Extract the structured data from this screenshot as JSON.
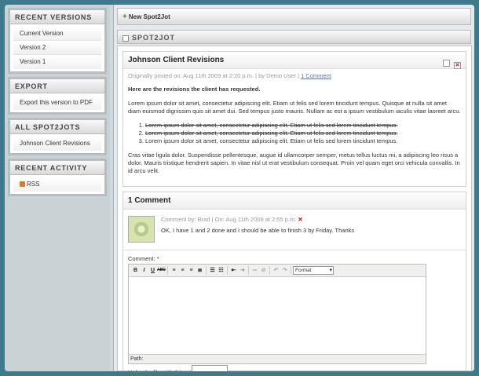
{
  "sidebar": {
    "recent_versions": {
      "title": "RECENT VERSIONS",
      "items": [
        "Current Version",
        "Version 2",
        "Version 1"
      ]
    },
    "export": {
      "title": "EXPORT",
      "items": [
        "Export this version to PDF"
      ]
    },
    "all_spot2jots": {
      "title": "ALL SPOT2JOTS",
      "items": [
        "Johnson Client Revisions"
      ]
    },
    "recent_activity": {
      "title": "RECENT ACTIVITY",
      "items": [
        "RSS"
      ]
    }
  },
  "toolbar": {
    "new_label": "New Spot2Jot"
  },
  "section": {
    "title": "SPOT2JOT"
  },
  "post": {
    "title": "Johnson Client Revisions",
    "meta_prefix": "Originally posted on: Aug 11th 2009 at 2:20 p.m. | by Demo User |",
    "meta_link": "1 Comment",
    "heading": "Here are the revisions the client has requested.",
    "para1": "Lorem ipsum dolor sit amet, consectetur adipiscing elit. Etiam ut felis sed lorem tincidunt tempus. Quisque at nulla sit amet diam euismod dignissim quis sit amet dui. Sed tempus justo mauris. Nullam ac est a ipsum vestibulum iaculis vitae laoreet arcu.",
    "list": [
      "Lorem ipsum dolor sit amet, consectetur adipiscing elit. Etiam ut felis sed lorem tincidunt tempus.",
      "Lorem ipsum dolor sit amet, consectetur adipiscing elit. Etiam ut felis sed lorem tincidunt tempus.",
      "Lorem ipsum dolor sit amet, consectetur adipiscing elit. Etiam ut felis sed lorem tincidunt tempus."
    ],
    "para2": "Cras vitae ligula dolor. Suspendisse pellentesque, augue id ullamcorper semper, metus tellus luctus mi, a adipiscing leo risus a dolor. Mauris tristique hendrerit sapien. In vitae nisl ut erat vestibulum consequat. Proin vel quam eget orci vehicula convallis. In id arcu velit."
  },
  "comments": {
    "title": "1 Comment",
    "items": [
      {
        "meta": "Comment by: Brad | On: Aug 11th 2009 at 2:55 p.m.",
        "text": "OK, I have 1 and 2 done and I should be able to finish 3 by Friday. Thanks"
      }
    ]
  },
  "form": {
    "comment_label": "Comment:",
    "required_mark": "*",
    "format_value": "Format",
    "path_label": "Path:",
    "upload_label": "Upload a file with this comment:"
  },
  "colors": {
    "background": "#3f7a8c",
    "plus_icon": "#2a9a2a",
    "delete_icon": "#cc0000",
    "link": "#5577aa"
  }
}
